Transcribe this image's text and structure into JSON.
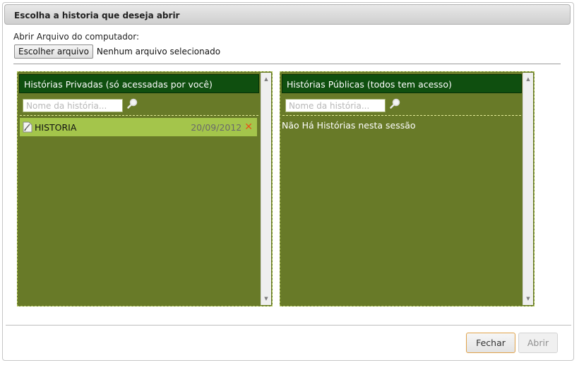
{
  "dialog": {
    "title": "Escolha a historia que deseja abrir"
  },
  "upload": {
    "label": "Abrir Arquivo do computador:",
    "choose_button": "Escolher arquivo",
    "status": "Nenhum arquivo selecionado"
  },
  "private_panel": {
    "title": "Histórias Privadas (só acessadas por você)",
    "search_placeholder": "Nome da história...",
    "search_value": "",
    "items": [
      {
        "name": "HISTORIA",
        "date": "20/09/2012",
        "delete_glyph": "✕"
      }
    ],
    "icons": [
      "search-icon",
      "document-icon",
      "delete-icon"
    ]
  },
  "public_panel": {
    "title": "Histórias Públicas (todos tem acesso)",
    "search_placeholder": "Nome da história...",
    "search_value": "",
    "empty_message": "Não Há Histórias nesta sessão"
  },
  "footer": {
    "close_label": "Fechar",
    "open_label": "Abrir"
  },
  "colors": {
    "panel_bg": "#687a28",
    "panel_header": "#0f4f0f",
    "selected_item": "#a4c54b",
    "delete": "#e8531a",
    "primary_button_border": "#e0a24a"
  }
}
